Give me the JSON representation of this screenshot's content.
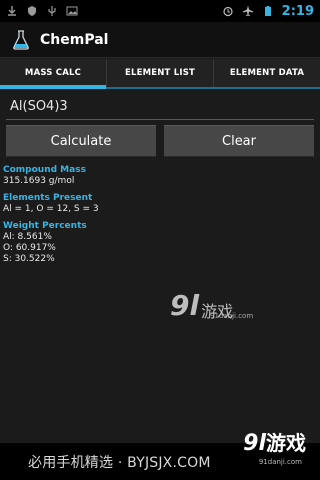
{
  "status_bar": {
    "time": "2:19",
    "left_icons": [
      "download-icon",
      "shield-icon",
      "usb-icon",
      "image-icon"
    ],
    "right_icons": [
      "alarm-icon",
      "airplane-icon",
      "battery-icon"
    ]
  },
  "app": {
    "title": "ChemPal",
    "icon": "flask-icon"
  },
  "tabs": [
    {
      "label": "MASS CALC",
      "active": true
    },
    {
      "label": "ELEMENT LIST",
      "active": false
    },
    {
      "label": "ELEMENT DATA",
      "active": false
    }
  ],
  "formula_input": {
    "value": "Al(SO4)3"
  },
  "buttons": {
    "calculate": "Calculate",
    "clear": "Clear"
  },
  "results": {
    "compound_mass_label": "Compound Mass",
    "compound_mass_value": "315.1693 g/mol",
    "elements_present_label": "Elements Present",
    "elements_present_value": "Al = 1, O = 12, S = 3",
    "weight_percents_label": "Weight Percents",
    "weight_percents": [
      "Al: 8.561%",
      "O: 60.917%",
      "S: 30.522%"
    ]
  },
  "watermark": {
    "center_mark": "9l",
    "center_zh": "游戏",
    "center_url": "91danji.com",
    "bottom_text": "必用手机精选 · BYJSJX.COM",
    "bottom_logo": "9l",
    "bottom_logo_zh": "游戏",
    "bottom_url": "91danji.com"
  },
  "colors": {
    "accent": "#33b5e5",
    "background": "#1b1b1b",
    "button": "#474747"
  }
}
